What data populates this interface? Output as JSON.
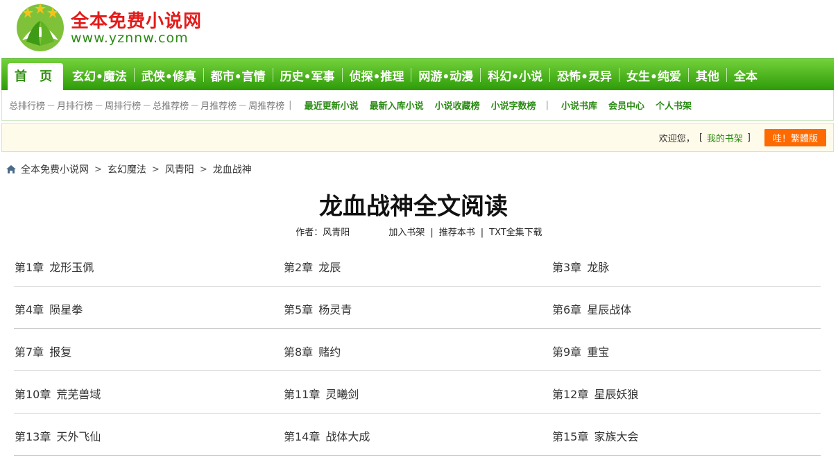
{
  "site": {
    "name": "全本免费小说网",
    "url": "www.yznnw.com"
  },
  "mainnav": {
    "home": "首 页",
    "items": [
      "玄幻•魔法",
      "武侠•修真",
      "都市•言情",
      "历史•军事",
      "侦探•推理",
      "网游•动漫",
      "科幻•小说",
      "恐怖•灵异",
      "女生•纯爱",
      "其他",
      "全本"
    ]
  },
  "subnav": {
    "ranks": [
      "总排行榜",
      "月排行榜",
      "周排行榜",
      "总推荐榜",
      "月推荐榜",
      "周推荐榜"
    ],
    "links_a": [
      "最近更新小说",
      "最新入库小说",
      "小说收藏榜",
      "小说字数榜"
    ],
    "links_b": [
      "小说书库",
      "会员中心",
      "个人书架"
    ]
  },
  "welcome": {
    "text": "欢迎您，",
    "open_bracket": "[",
    "shelf": "我的书架",
    "close_bracket": "]",
    "traditional": "哇！繁體版"
  },
  "breadcrumb": [
    "全本免费小说网",
    "玄幻魔法",
    "风青阳",
    "龙血战神"
  ],
  "book": {
    "title": "龙血战神全文阅读",
    "author_label": "作者：风青阳",
    "add_shelf": "加入书架",
    "recommend": "推荐本书",
    "download": "TXT全集下载"
  },
  "chapters": [
    {
      "num": "第1章",
      "title": "龙形玉佩"
    },
    {
      "num": "第2章",
      "title": "龙辰"
    },
    {
      "num": "第3章",
      "title": "龙脉"
    },
    {
      "num": "第4章",
      "title": "陨星拳"
    },
    {
      "num": "第5章",
      "title": "杨灵青"
    },
    {
      "num": "第6章",
      "title": "星辰战体"
    },
    {
      "num": "第7章",
      "title": "报复"
    },
    {
      "num": "第8章",
      "title": "赌约"
    },
    {
      "num": "第9章",
      "title": "重宝"
    },
    {
      "num": "第10章",
      "title": "荒芜兽域"
    },
    {
      "num": "第11章",
      "title": "灵曦剑"
    },
    {
      "num": "第12章",
      "title": "星辰妖狼"
    },
    {
      "num": "第13章",
      "title": "天外飞仙"
    },
    {
      "num": "第14章",
      "title": "战体大成"
    },
    {
      "num": "第15章",
      "title": "家族大会"
    }
  ]
}
